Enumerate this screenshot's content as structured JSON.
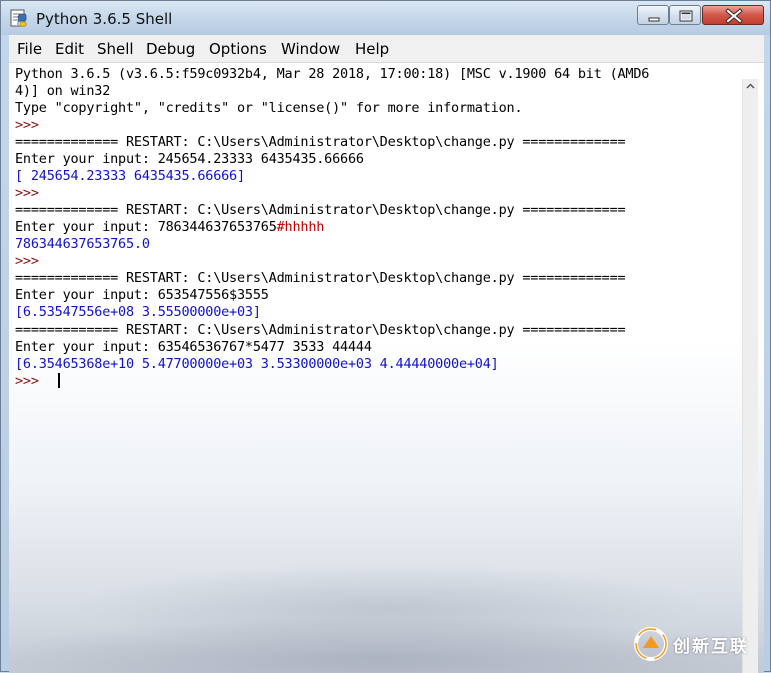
{
  "window": {
    "title": "Python 3.6.5 Shell",
    "app_icon": "python-idle-icon",
    "controls": [
      "minimize-icon",
      "maximize-icon",
      "close-icon"
    ]
  },
  "menubar": {
    "items": [
      "File",
      "Edit",
      "Shell",
      "Debug",
      "Options",
      "Window",
      "Help"
    ]
  },
  "shell": {
    "banner_1": "Python 3.6.5 (v3.6.5:f59c0932b4, Mar 28 2018, 17:00:18) [MSC v.1900 64 bit (AMD6",
    "banner_2": "4)] on win32",
    "banner_3": "Type \"copyright\", \"credits\" or \"license()\" for more information.",
    "prompt": ">>>",
    "runs": [
      {
        "restart": "============= RESTART: C:\\Users\\Administrator\\Desktop\\change.py =============",
        "input_label": "Enter your input: ",
        "input_value": "245654.23333 6435435.66666",
        "input_comment": "",
        "output": "[ 245654.23333 6435435.66666]"
      },
      {
        "restart": "============= RESTART: C:\\Users\\Administrator\\Desktop\\change.py =============",
        "input_label": "Enter your input: ",
        "input_value": "786344637653765",
        "input_comment": "#hhhhh",
        "output": "786344637653765.0"
      },
      {
        "restart": "============= RESTART: C:\\Users\\Administrator\\Desktop\\change.py =============",
        "input_label": "Enter your input: ",
        "input_value": "653547556$3555",
        "input_comment": "",
        "output": "[6.53547556e+08 3.55500000e+03]"
      },
      {
        "restart": "============= RESTART: C:\\Users\\Administrator\\Desktop\\change.py =============",
        "input_label": "Enter your input: ",
        "input_value": "63546536767*5477 3533 44444",
        "input_comment": "",
        "output": "[6.35465368e+10 5.47700000e+03 3.53300000e+03 4.44440000e+04]"
      }
    ]
  },
  "watermark": {
    "logo": "chuangxin-hulian-logo",
    "text": "创新互联"
  }
}
